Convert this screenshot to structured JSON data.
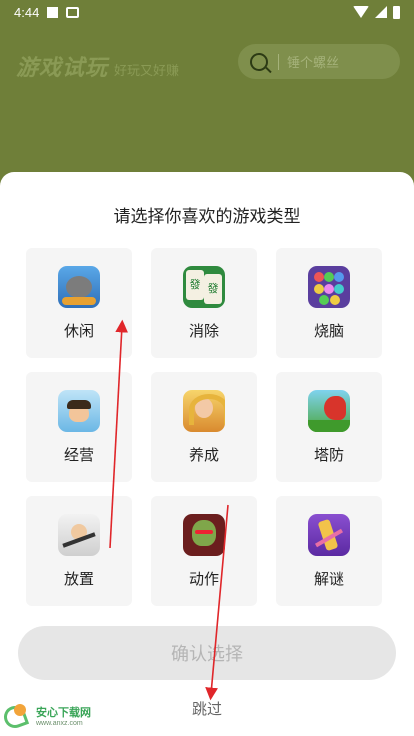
{
  "status_bar": {
    "time": "4:44"
  },
  "header": {
    "app_title": "游戏试玩",
    "app_subtitle": "好玩又好赚",
    "search_placeholder": "锤个螺丝"
  },
  "sheet": {
    "title": "请选择你喜欢的游戏类型",
    "categories": [
      {
        "label": "休闲",
        "icon": "leisure-game-icon"
      },
      {
        "label": "消除",
        "icon": "mahjong-game-icon"
      },
      {
        "label": "烧脑",
        "icon": "brain-puzzle-icon"
      },
      {
        "label": "经营",
        "icon": "business-game-icon"
      },
      {
        "label": "养成",
        "icon": "raising-game-icon"
      },
      {
        "label": "塔防",
        "icon": "tower-defense-icon"
      },
      {
        "label": "放置",
        "icon": "idle-game-icon"
      },
      {
        "label": "动作",
        "icon": "action-game-icon"
      },
      {
        "label": "解谜",
        "icon": "puzzle-game-icon"
      }
    ],
    "confirm_label": "确认选择",
    "skip_label": "跳过"
  },
  "watermark": {
    "name": "安心下载网",
    "url": "www.anxz.com"
  },
  "colors": {
    "backdrop": "#6f7f39",
    "sheet": "#ffffff",
    "card": "#f5f5f5",
    "button_disabled": "#e6e6e6",
    "annotation": "#e0262a"
  }
}
